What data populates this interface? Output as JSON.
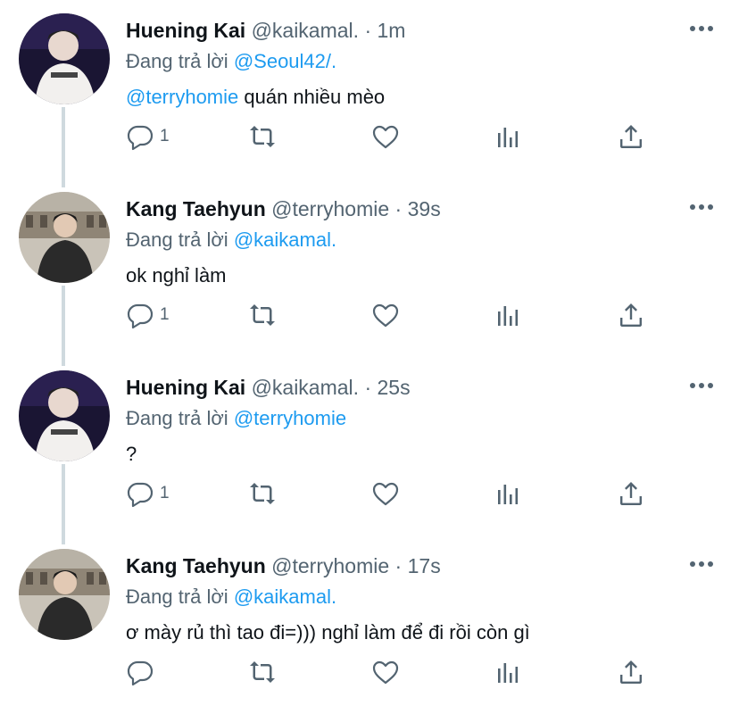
{
  "colors": {
    "accent": "#1d9bf0",
    "muted": "#536471",
    "text": "#0f1419",
    "thread": "#cfd9de"
  },
  "tweets": [
    {
      "name": "Huening Kai",
      "handle": "@kaikamal.",
      "dot": "·",
      "time": "1m",
      "replying_prefix": "Đang trả lời",
      "replying_to": "@Seoul42/.",
      "mention": "@terryhomie",
      "text": " quán nhiều mèo",
      "reply_count": "1",
      "avatar_icon": "avatar-huening-kai"
    },
    {
      "name": "Kang Taehyun",
      "handle": "@terryhomie",
      "dot": "·",
      "time": "39s",
      "replying_prefix": "Đang trả lời",
      "replying_to": "@kaikamal.",
      "mention": "",
      "text": "ok nghỉ làm",
      "reply_count": "1",
      "avatar_icon": "avatar-kang-taehyun"
    },
    {
      "name": "Huening Kai",
      "handle": "@kaikamal.",
      "dot": "·",
      "time": "25s",
      "replying_prefix": "Đang trả lời",
      "replying_to": "@terryhomie",
      "mention": "",
      "text": "?",
      "reply_count": "1",
      "avatar_icon": "avatar-huening-kai"
    },
    {
      "name": "Kang Taehyun",
      "handle": "@terryhomie",
      "dot": "·",
      "time": "17s",
      "replying_prefix": "Đang trả lời",
      "replying_to": "@kaikamal.",
      "mention": "",
      "text": "ơ mày rủ thì tao đi=))) nghỉ làm để đi rồi còn gì",
      "reply_count": "",
      "avatar_icon": "avatar-kang-taehyun"
    }
  ]
}
